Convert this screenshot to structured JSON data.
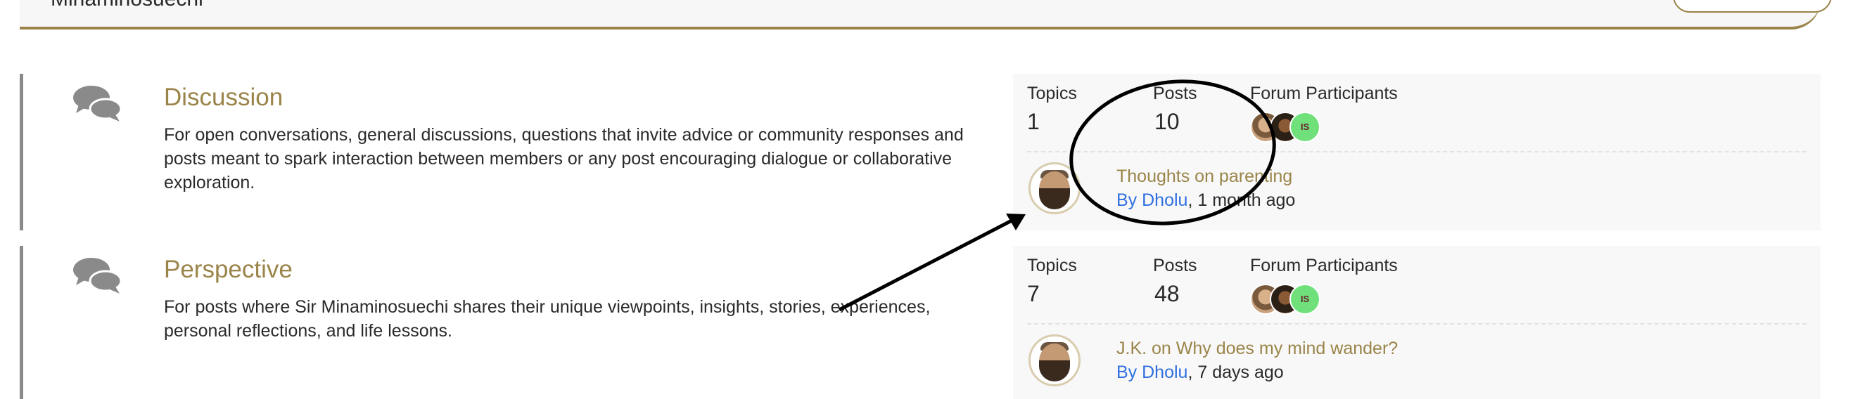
{
  "header": {
    "site_title": "Minaminosuechi"
  },
  "forums": [
    {
      "title": "Discussion",
      "description": "For open conversations, general discussions, questions that invite advice or community responses and posts meant to spark interaction between members or any post encouraging dialogue or collaborative exploration.",
      "stats": {
        "topics_label": "Topics",
        "topics_value": "1",
        "posts_label": "Posts",
        "posts_value": "10",
        "participants_label": "Forum Participants",
        "participant_initials": "IS"
      },
      "latest": {
        "topic": "Thoughts on parenting",
        "by": "By Dholu",
        "time": ", 1 month ago"
      }
    },
    {
      "title": "Perspective",
      "description": "For posts where Sir Minaminosuechi shares their unique viewpoints, insights, stories, experiences, personal reflections, and life lessons.",
      "stats": {
        "topics_label": "Topics",
        "topics_value": "7",
        "posts_label": "Posts",
        "posts_value": "48",
        "participants_label": "Forum Participants",
        "participant_initials": "IS"
      },
      "latest": {
        "topic": "J.K. on Why does my mind wander?",
        "by": "By Dholu",
        "time": ", 7 days ago"
      }
    }
  ],
  "colors": {
    "accent_gold": "#9a8449",
    "link_blue": "#2f6fe0",
    "annotation": "#000000"
  },
  "icons": {
    "forum_icon": "chat-bubbles-icon"
  }
}
